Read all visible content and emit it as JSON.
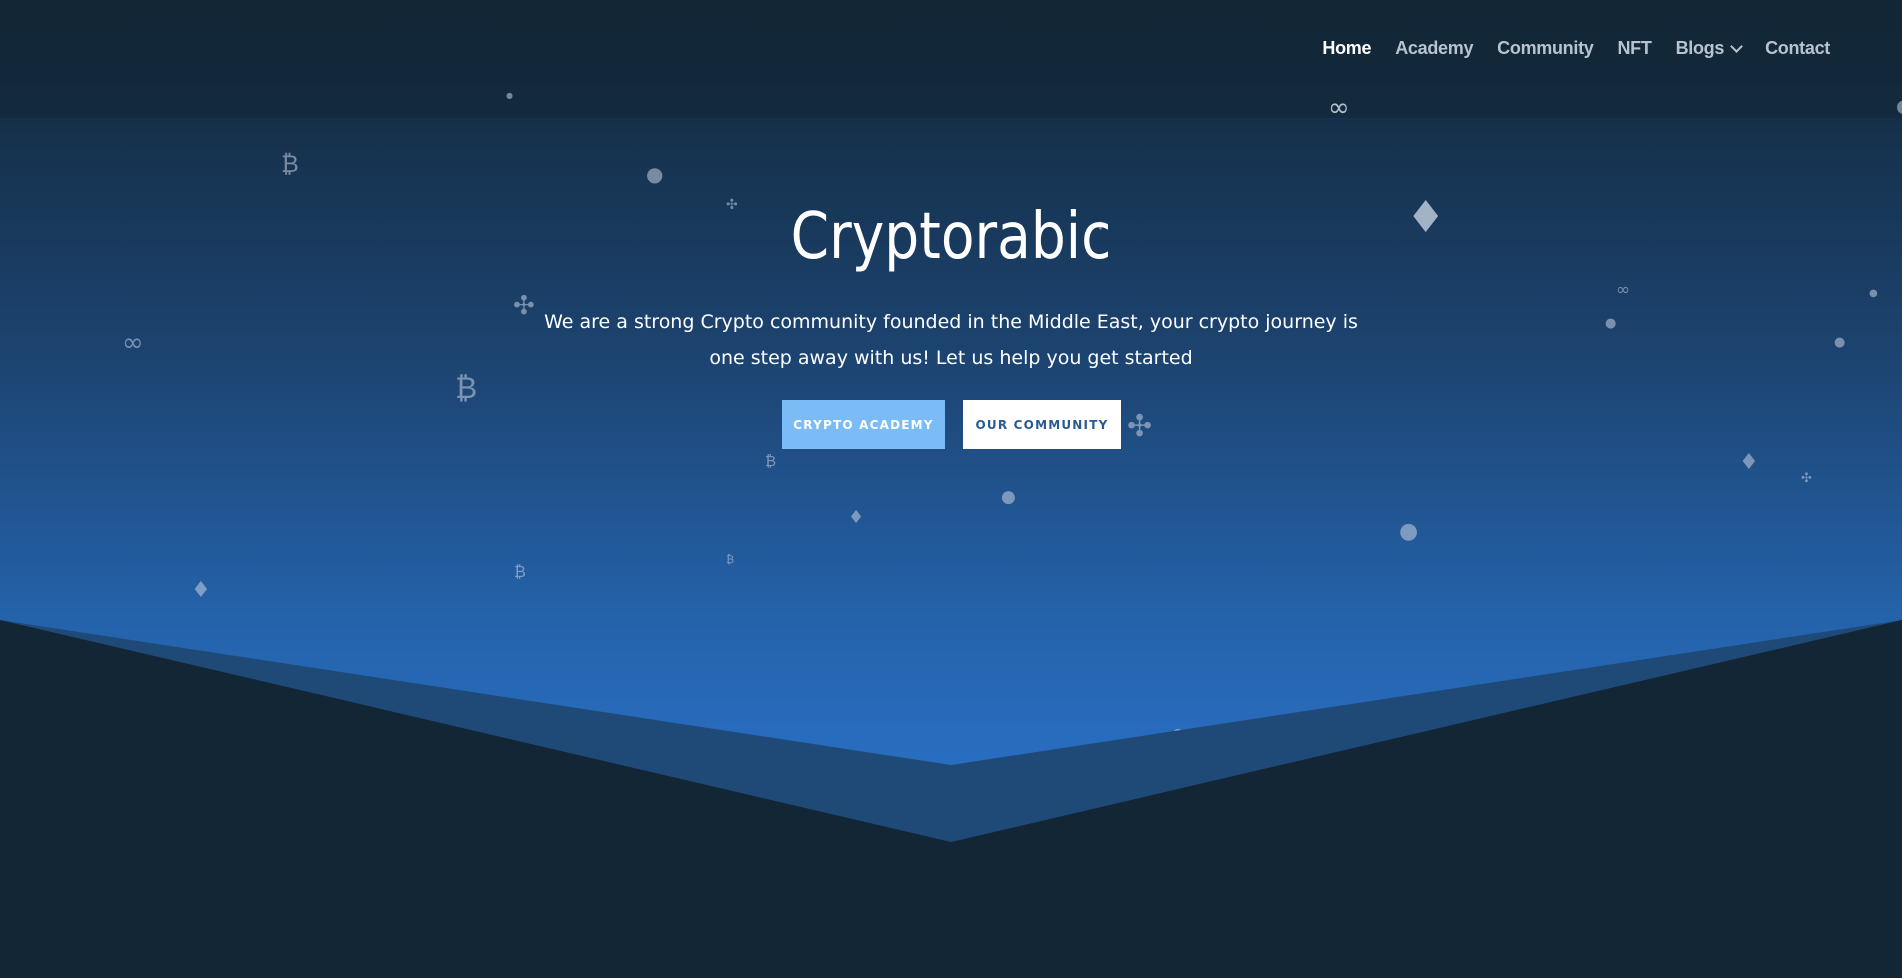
{
  "nav": {
    "items": [
      {
        "label": "Home",
        "active": true
      },
      {
        "label": "Academy"
      },
      {
        "label": "Community"
      },
      {
        "label": "NFT"
      },
      {
        "label": "Blogs",
        "has_dropdown": true
      },
      {
        "label": "Contact"
      }
    ]
  },
  "hero": {
    "title": "Cryptorabic",
    "subtitle": "We are a strong Crypto community founded in the Middle East, your crypto journey is one step away with us! Let us help you get started",
    "buttons": {
      "academy": "CRYPTO ACADEMY",
      "community": "OUR COMMUNITY"
    }
  },
  "colors": {
    "header_bg": "#132838",
    "gradient_bottom": "#2a6fc4",
    "bottom_section": "#122636",
    "mid_shape": "#1f4a78",
    "button_academy_bg": "#7bbcf6",
    "button_community_bg": "#ffffff",
    "button_community_text": "#2a5a94"
  },
  "decorations": {
    "icons": [
      "bitcoin-icon",
      "ethereum-icon",
      "polygon-icon",
      "ripple-icon",
      "coin-icon"
    ]
  }
}
